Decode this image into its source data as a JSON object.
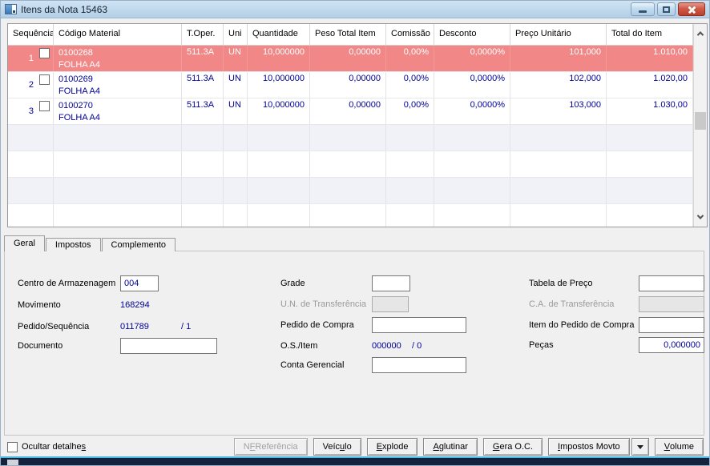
{
  "window": {
    "title": "Itens da Nota 15463",
    "controls": {
      "minimize": "minimize",
      "restore": "restore",
      "close": "close"
    }
  },
  "colors": {
    "titlebar": "#bcd5ea",
    "selected_row_bg": "#f28787",
    "selected_row_text": "#ffffff",
    "data_text": "#000096",
    "close_button": "#c6473a",
    "panel_bg": "#f0f0f0",
    "strip_accent": "#49b6e4",
    "strip_bg": "#13233d"
  },
  "grid": {
    "columns": [
      "Sequência",
      "Código Material",
      "T.Oper.",
      "Uni",
      "Quantidade",
      "Peso Total Item",
      "Comissão",
      "Desconto",
      "Preço Unitário",
      "Total do Item"
    ],
    "rows": [
      {
        "seq": "1",
        "code": "0100268",
        "desc": "FOLHA A4",
        "toper": "511.3A",
        "uni": "UN",
        "qty": "10,000000",
        "peso": "0,00000",
        "comissao": "0,00%",
        "desconto": "0,0000%",
        "preco": "101,000",
        "total": "1.010,00"
      },
      {
        "seq": "2",
        "code": "0100269",
        "desc": "FOLHA A4",
        "toper": "511.3A",
        "uni": "UN",
        "qty": "10,000000",
        "peso": "0,00000",
        "comissao": "0,00%",
        "desconto": "0,0000%",
        "preco": "102,000",
        "total": "1.020,00"
      },
      {
        "seq": "3",
        "code": "0100270",
        "desc": "FOLHA A4",
        "toper": "511.3A",
        "uni": "UN",
        "qty": "10,000000",
        "peso": "0,00000",
        "comissao": "0,00%",
        "desconto": "0,0000%",
        "preco": "103,000",
        "total": "1.030,00"
      }
    ]
  },
  "tabs": [
    {
      "label": "Geral",
      "active": true
    },
    {
      "label": "Impostos",
      "active": false
    },
    {
      "label": "Complemento",
      "active": false
    }
  ],
  "form": {
    "centro_armazenagem": {
      "label": "Centro de Armazenagem",
      "value": "004"
    },
    "movimento": {
      "label": "Movimento",
      "value": "168294"
    },
    "pedido_sequencia": {
      "label": "Pedido/Sequência",
      "value": "011789",
      "value2": "/ 1"
    },
    "documento": {
      "label": "Documento",
      "value": ""
    },
    "grade": {
      "label": "Grade",
      "value": ""
    },
    "un_transferencia": {
      "label": "U.N. de Transferência",
      "value": ""
    },
    "pedido_compra": {
      "label": "Pedido de Compra",
      "value": ""
    },
    "os_item": {
      "label": "O.S./Item",
      "value": "000000",
      "value2": "/ 0"
    },
    "conta_gerencial": {
      "label": "Conta Gerencial",
      "value": ""
    },
    "tabela_preco": {
      "label": "Tabela de Preço",
      "value": ""
    },
    "ca_transferencia": {
      "label": "C.A. de Transferência",
      "value": ""
    },
    "item_pedido_compra": {
      "label": "Item do Pedido de Compra",
      "value": ""
    },
    "pecas": {
      "label": "Peças",
      "value": "0,000000"
    }
  },
  "footer": {
    "hide_details": {
      "pre": "Ocultar detalhe",
      "key": "s",
      "post": ""
    },
    "buttons": [
      {
        "pre": "N",
        "key": "F",
        "post": " Referência",
        "disabled": true
      },
      {
        "pre": "Veíc",
        "key": "u",
        "post": "lo",
        "disabled": false
      },
      {
        "pre": "",
        "key": "E",
        "post": "xplode",
        "disabled": false
      },
      {
        "pre": "",
        "key": "A",
        "post": "glutinar",
        "disabled": false
      },
      {
        "pre": "",
        "key": "G",
        "post": "era O.C.",
        "disabled": false
      },
      {
        "pre": "",
        "key": "I",
        "post": "mpostos Movto",
        "disabled": false
      },
      {
        "pre": "",
        "key": "V",
        "post": "olume",
        "disabled": false
      }
    ]
  }
}
